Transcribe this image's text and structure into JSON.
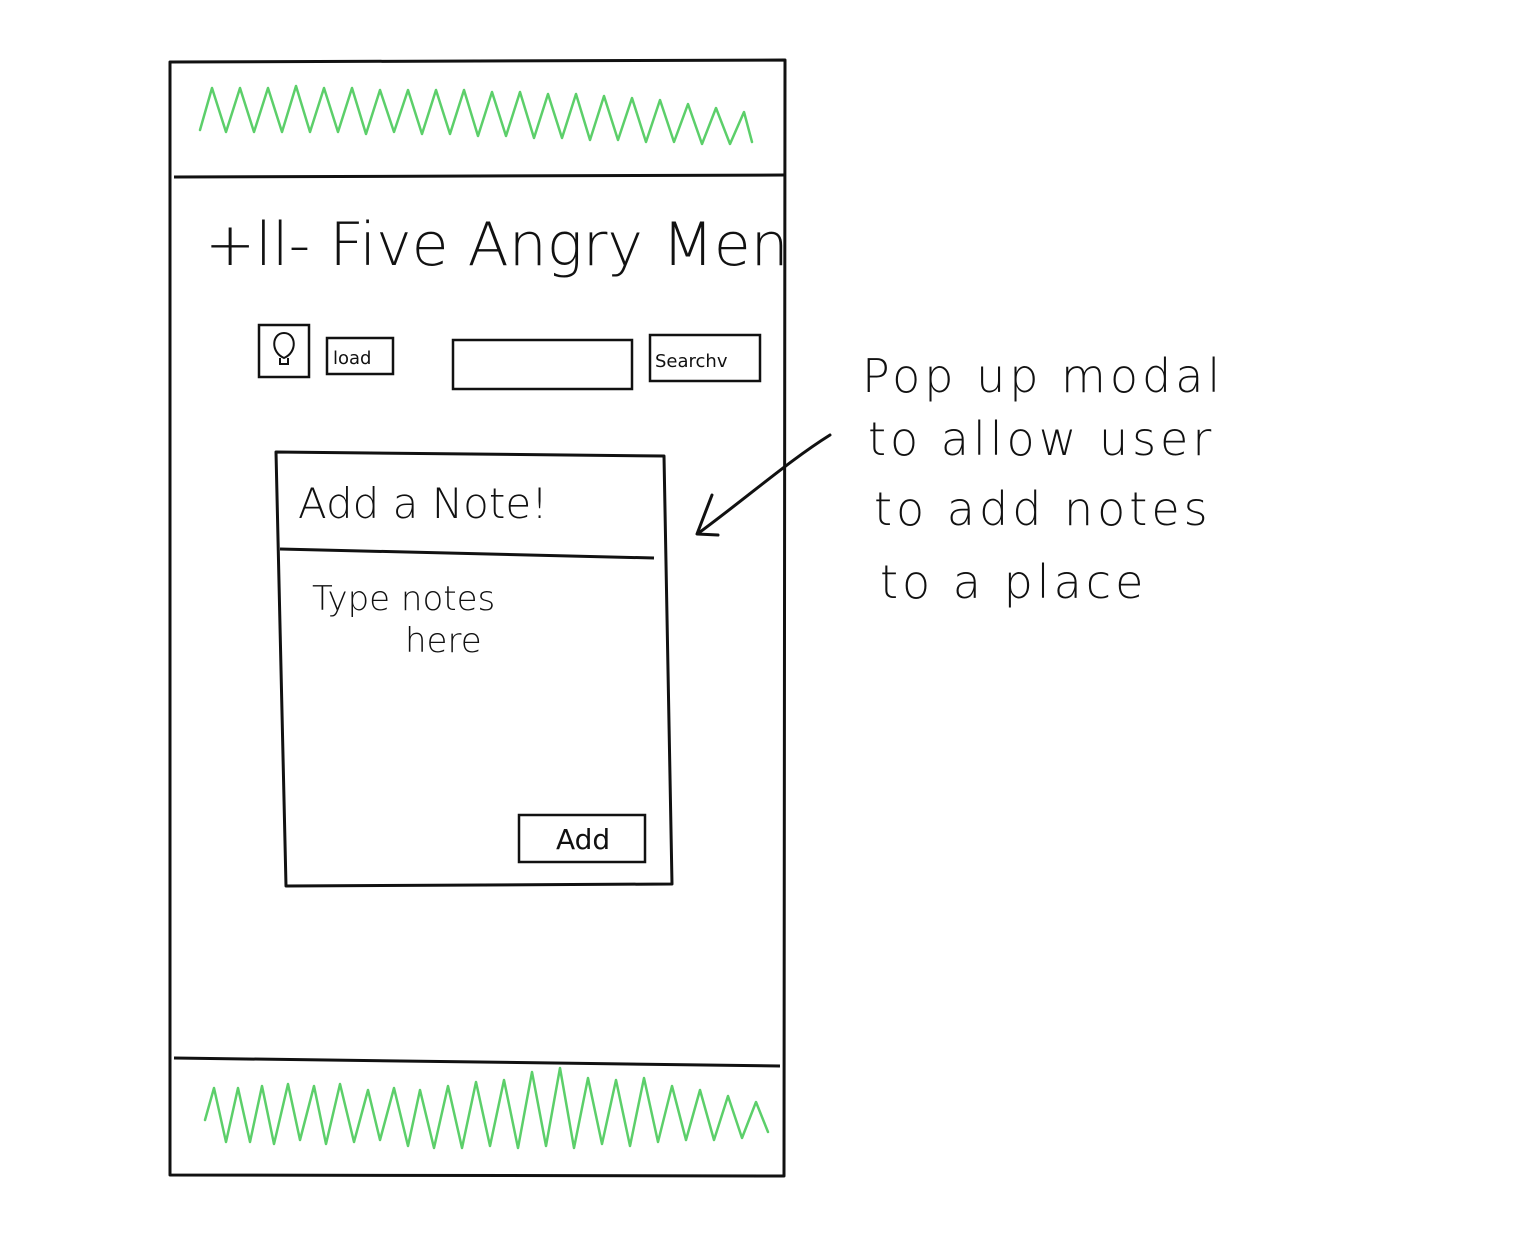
{
  "app": {
    "title": "+ll- Five Angry Men"
  },
  "toolbar": {
    "load_label": "load",
    "search_button_label": "Searchv",
    "search_input_value": ""
  },
  "modal": {
    "title": "Add a Note!",
    "body_text_line1": "Type notes",
    "body_text_line2": "here",
    "add_button_label": "Add"
  },
  "annotation": {
    "line1": "Pop up modal",
    "line2": "to allow user",
    "line3": "to add notes",
    "line4": "to a place"
  },
  "colors": {
    "ink": "#111111",
    "scribble": "#5ccf6a",
    "background": "#ffffff"
  },
  "icons": {
    "toolbar_icon": "lightbulb-icon"
  }
}
